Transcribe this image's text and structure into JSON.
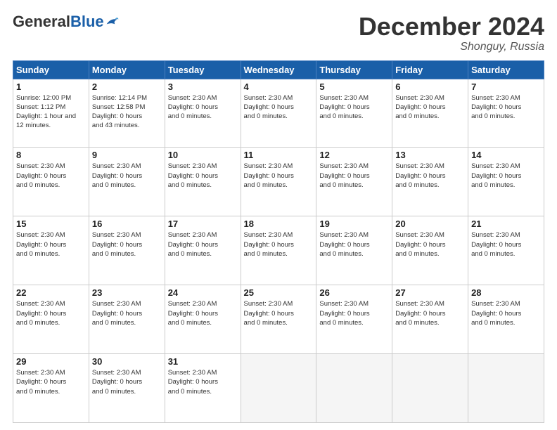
{
  "header": {
    "logo_general": "General",
    "logo_blue": "Blue",
    "month_title": "December 2024",
    "location": "Shonguy, Russia"
  },
  "weekdays": [
    "Sunday",
    "Monday",
    "Tuesday",
    "Wednesday",
    "Thursday",
    "Friday",
    "Saturday"
  ],
  "cells": [
    {
      "day": "",
      "empty": true,
      "info": ""
    },
    {
      "day": "2",
      "empty": false,
      "info": "Sunrise: 12:14 PM\nSunset: 12:58 PM\nDaylight: 0 hours\nand 43 minutes."
    },
    {
      "day": "3",
      "empty": false,
      "info": "Sunset: 2:30 AM\nDaylight: 0 hours\nand 0 minutes."
    },
    {
      "day": "4",
      "empty": false,
      "info": "Sunset: 2:30 AM\nDaylight: 0 hours\nand 0 minutes."
    },
    {
      "day": "5",
      "empty": false,
      "info": "Sunset: 2:30 AM\nDaylight: 0 hours\nand 0 minutes."
    },
    {
      "day": "6",
      "empty": false,
      "info": "Sunset: 2:30 AM\nDaylight: 0 hours\nand 0 minutes."
    },
    {
      "day": "7",
      "empty": false,
      "info": "Sunset: 2:30 AM\nDaylight: 0 hours\nand 0 minutes."
    },
    {
      "day": "8",
      "empty": false,
      "info": "Sunset: 2:30 AM\nDaylight: 0 hours\nand 0 minutes."
    },
    {
      "day": "9",
      "empty": false,
      "info": "Sunset: 2:30 AM\nDaylight: 0 hours\nand 0 minutes."
    },
    {
      "day": "10",
      "empty": false,
      "info": "Sunset: 2:30 AM\nDaylight: 0 hours\nand 0 minutes."
    },
    {
      "day": "11",
      "empty": false,
      "info": "Sunset: 2:30 AM\nDaylight: 0 hours\nand 0 minutes."
    },
    {
      "day": "12",
      "empty": false,
      "info": "Sunset: 2:30 AM\nDaylight: 0 hours\nand 0 minutes."
    },
    {
      "day": "13",
      "empty": false,
      "info": "Sunset: 2:30 AM\nDaylight: 0 hours\nand 0 minutes."
    },
    {
      "day": "14",
      "empty": false,
      "info": "Sunset: 2:30 AM\nDaylight: 0 hours\nand 0 minutes."
    },
    {
      "day": "15",
      "empty": false,
      "info": "Sunset: 2:30 AM\nDaylight: 0 hours\nand 0 minutes."
    },
    {
      "day": "16",
      "empty": false,
      "info": "Sunset: 2:30 AM\nDaylight: 0 hours\nand 0 minutes."
    },
    {
      "day": "17",
      "empty": false,
      "info": "Sunset: 2:30 AM\nDaylight: 0 hours\nand 0 minutes."
    },
    {
      "day": "18",
      "empty": false,
      "info": "Sunset: 2:30 AM\nDaylight: 0 hours\nand 0 minutes."
    },
    {
      "day": "19",
      "empty": false,
      "info": "Sunset: 2:30 AM\nDaylight: 0 hours\nand 0 minutes."
    },
    {
      "day": "20",
      "empty": false,
      "info": "Sunset: 2:30 AM\nDaylight: 0 hours\nand 0 minutes."
    },
    {
      "day": "21",
      "empty": false,
      "info": "Sunset: 2:30 AM\nDaylight: 0 hours\nand 0 minutes."
    },
    {
      "day": "22",
      "empty": false,
      "info": "Sunset: 2:30 AM\nDaylight: 0 hours\nand 0 minutes."
    },
    {
      "day": "23",
      "empty": false,
      "info": "Sunset: 2:30 AM\nDaylight: 0 hours\nand 0 minutes."
    },
    {
      "day": "24",
      "empty": false,
      "info": "Sunset: 2:30 AM\nDaylight: 0 hours\nand 0 minutes."
    },
    {
      "day": "25",
      "empty": false,
      "info": "Sunset: 2:30 AM\nDaylight: 0 hours\nand 0 minutes."
    },
    {
      "day": "26",
      "empty": false,
      "info": "Sunset: 2:30 AM\nDaylight: 0 hours\nand 0 minutes."
    },
    {
      "day": "27",
      "empty": false,
      "info": "Sunset: 2:30 AM\nDaylight: 0 hours\nand 0 minutes."
    },
    {
      "day": "28",
      "empty": false,
      "info": "Sunset: 2:30 AM\nDaylight: 0 hours\nand 0 minutes."
    },
    {
      "day": "29",
      "empty": false,
      "info": "Sunset: 2:30 AM\nDaylight: 0 hours\nand 0 minutes."
    },
    {
      "day": "30",
      "empty": false,
      "info": "Sunset: 2:30 AM\nDaylight: 0 hours\nand 0 minutes."
    },
    {
      "day": "31",
      "empty": false,
      "info": "Sunset: 2:30 AM\nDaylight: 0 hours\nand 0 minutes."
    },
    {
      "day": "",
      "empty": true,
      "info": ""
    },
    {
      "day": "",
      "empty": true,
      "info": ""
    },
    {
      "day": "",
      "empty": true,
      "info": ""
    },
    {
      "day": "",
      "empty": true,
      "info": ""
    }
  ],
  "day1": {
    "day": "1",
    "info": "Sunrise: 12:00 PM\nSunset: 1:12 PM\nDaylight: 1 hour and\n12 minutes."
  }
}
